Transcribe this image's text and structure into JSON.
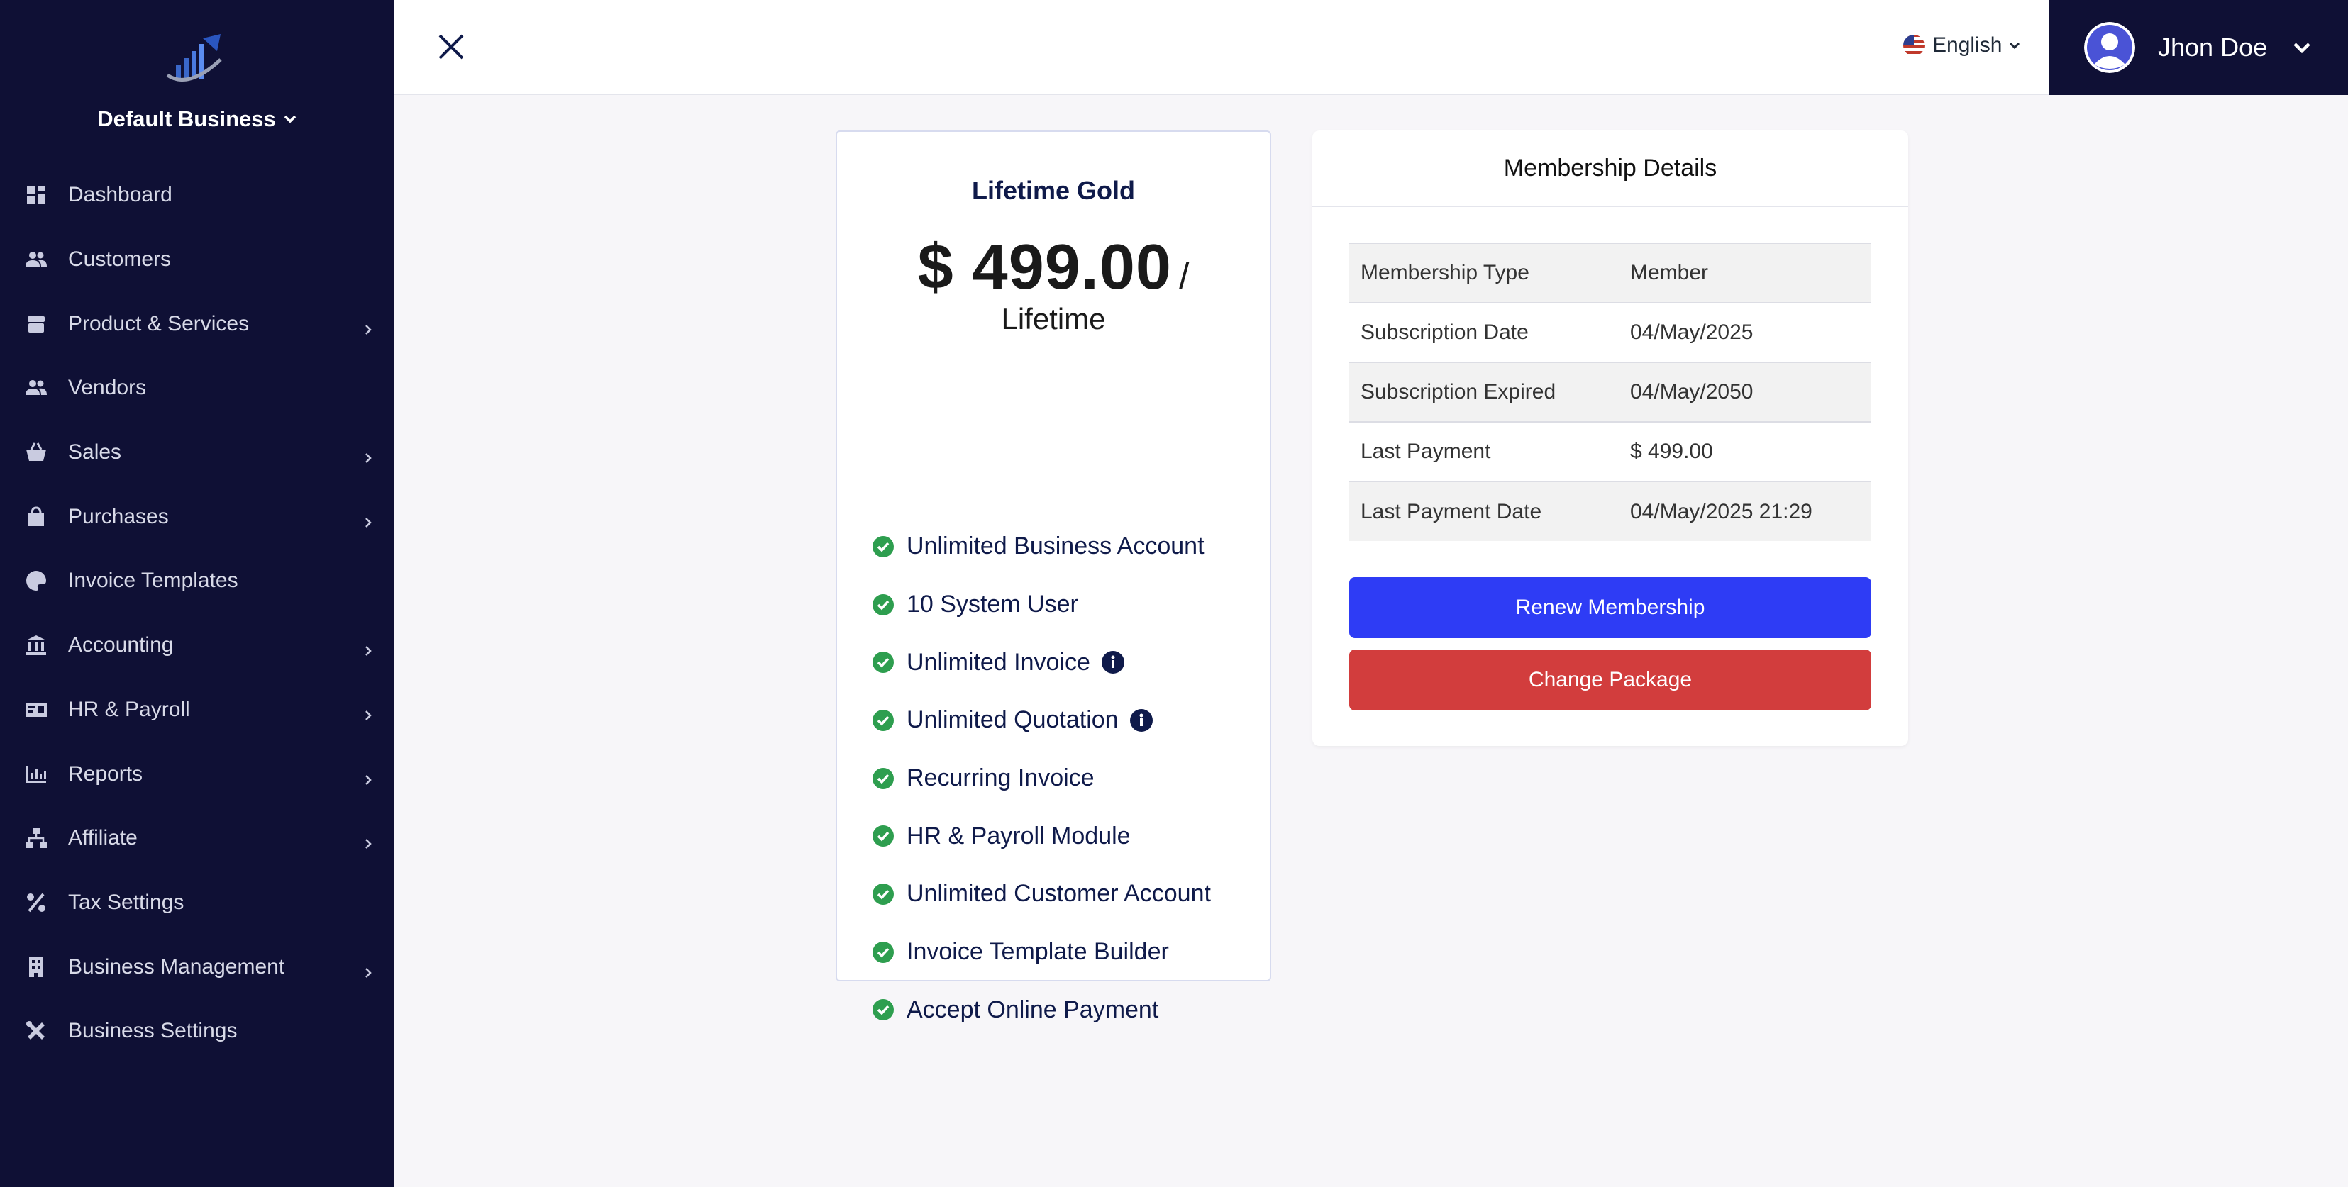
{
  "sidebar": {
    "business_name": "Default Business",
    "items": [
      {
        "label": "Dashboard",
        "icon": "dashboard-icon",
        "has_submenu": false
      },
      {
        "label": "Customers",
        "icon": "users-icon",
        "has_submenu": false
      },
      {
        "label": "Product & Services",
        "icon": "box-icon",
        "has_submenu": true
      },
      {
        "label": "Vendors",
        "icon": "users-icon",
        "has_submenu": false
      },
      {
        "label": "Sales",
        "icon": "basket-icon",
        "has_submenu": true
      },
      {
        "label": "Purchases",
        "icon": "bag-icon",
        "has_submenu": true
      },
      {
        "label": "Invoice Templates",
        "icon": "palette-icon",
        "has_submenu": false
      },
      {
        "label": "Accounting",
        "icon": "bank-icon",
        "has_submenu": true
      },
      {
        "label": "HR & Payroll",
        "icon": "id-card-icon",
        "has_submenu": true
      },
      {
        "label": "Reports",
        "icon": "chart-icon",
        "has_submenu": true
      },
      {
        "label": "Affiliate",
        "icon": "network-icon",
        "has_submenu": true
      },
      {
        "label": "Tax Settings",
        "icon": "percent-icon",
        "has_submenu": false
      },
      {
        "label": "Business Management",
        "icon": "building-icon",
        "has_submenu": true
      },
      {
        "label": "Business Settings",
        "icon": "tools-icon",
        "has_submenu": false
      }
    ]
  },
  "topbar": {
    "language": "English",
    "user_name": "Jhon Doe"
  },
  "plan": {
    "name": "Lifetime Gold",
    "price": "$ 499.00",
    "slash": "/",
    "period": "Lifetime",
    "features": [
      {
        "label": "Unlimited Business Account",
        "info": false
      },
      {
        "label": "10 System User",
        "info": false
      },
      {
        "label": "Unlimited Invoice",
        "info": true
      },
      {
        "label": "Unlimited Quotation",
        "info": true
      },
      {
        "label": "Recurring Invoice",
        "info": false
      },
      {
        "label": "HR & Payroll Module",
        "info": false
      },
      {
        "label": "Unlimited Customer Account",
        "info": false
      },
      {
        "label": "Invoice Template Builder",
        "info": false
      },
      {
        "label": "Accept Online Payment",
        "info": false
      }
    ]
  },
  "membership": {
    "title": "Membership Details",
    "rows": [
      {
        "key": "Membership Type",
        "value": "Member"
      },
      {
        "key": "Subscription Date",
        "value": "04/May/2025"
      },
      {
        "key": "Subscription Expired",
        "value": "04/May/2050"
      },
      {
        "key": "Last Payment",
        "value": "$ 499.00"
      },
      {
        "key": "Last Payment Date",
        "value": "04/May/2025 21:29"
      }
    ],
    "renew_label": "Renew Membership",
    "change_label": "Change Package"
  },
  "colors": {
    "sidebar_bg": "#0f1035",
    "primary_button": "#2e3cf5",
    "danger_button": "#d23d3d",
    "check_green": "#2e9e4f"
  }
}
